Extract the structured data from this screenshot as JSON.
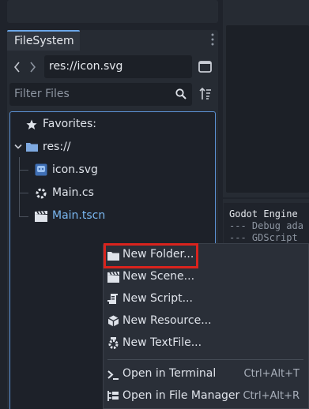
{
  "filesystem": {
    "tab_label": "FileSystem",
    "path_value": "res://icon.svg",
    "filter_placeholder": "Filter Files"
  },
  "tree": {
    "favorites": "Favorites:",
    "root": "res://",
    "files": [
      {
        "name": "icon.svg",
        "icon": "svg-image-icon"
      },
      {
        "name": "Main.cs",
        "icon": "csharp-script-icon"
      },
      {
        "name": "Main.tscn",
        "icon": "scene-icon"
      }
    ]
  },
  "context_menu": {
    "items": [
      {
        "label": "New Folder...",
        "icon": "folder-icon"
      },
      {
        "label": "New Scene...",
        "icon": "scene-icon"
      },
      {
        "label": "New Script...",
        "icon": "script-icon"
      },
      {
        "label": "New Resource...",
        "icon": "resource-icon"
      },
      {
        "label": "New TextFile...",
        "icon": "textfile-icon"
      },
      {
        "label": "Open in Terminal",
        "shortcut": "Ctrl+Alt+T",
        "icon": "terminal-icon"
      },
      {
        "label": "Open in File Manager",
        "shortcut": "Ctrl+Alt+R",
        "icon": "file-manager-icon"
      }
    ]
  },
  "console": {
    "lines": [
      "Godot Engine",
      "--- Debug ada",
      "--- GDScript"
    ]
  },
  "colors": {
    "accent": "#6aa6e8",
    "highlight": "#d9231d",
    "folder": "#7ea9e0",
    "selected_file": "#7ab7f0"
  }
}
